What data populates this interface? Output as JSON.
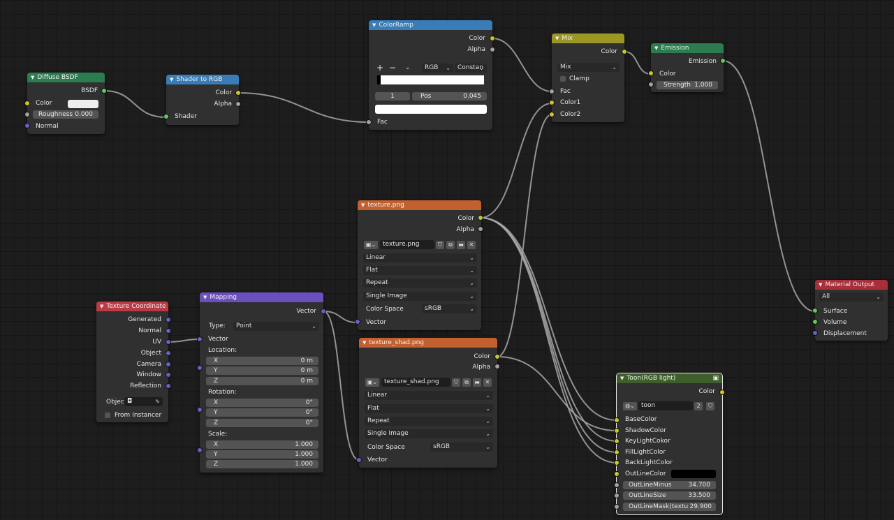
{
  "colors": {
    "shader_header": "#2b7d4f",
    "converter_header": "#3a7db6",
    "color_header": "#9c9626",
    "texture_header": "#c2612f",
    "input_header": "#b83b45",
    "vector_header": "#6c4fbf",
    "output_header": "#a82e3a",
    "group_header": "#3e5f2c",
    "socket_color": "#c7c729",
    "socket_float": "#a1a1a1",
    "socket_shader": "#63c763",
    "socket_vector": "#6363c7"
  },
  "diffuse": {
    "title": "Diffuse BSDF",
    "out_bsdf": "BSDF",
    "in_color": "Color",
    "roughness_label": "Roughness",
    "roughness_value": "0.000",
    "in_normal": "Normal"
  },
  "shader_to_rgb": {
    "title": "Shader to RGB",
    "out_color": "Color",
    "out_alpha": "Alpha",
    "in_shader": "Shader"
  },
  "colorramp": {
    "title": "ColorRamp",
    "out_color": "Color",
    "out_alpha": "Alpha",
    "add_icon": "+",
    "remove_icon": "−",
    "menu_icon": "⌄",
    "mode": "RGB",
    "interpolation": "Constan",
    "index": "1",
    "pos_label": "Pos",
    "pos_value": "0.045",
    "in_fac": "Fac"
  },
  "mix": {
    "title": "Mix",
    "out_color": "Color",
    "blend_mode": "Mix",
    "clamp_label": "Clamp",
    "in_fac": "Fac",
    "in_color1": "Color1",
    "in_color2": "Color2"
  },
  "emission": {
    "title": "Emission",
    "out_emission": "Emission",
    "in_color": "Color",
    "strength_label": "Strength",
    "strength_value": "1.000"
  },
  "material_output": {
    "title": "Material Output",
    "target": "All",
    "in_surface": "Surface",
    "in_volume": "Volume",
    "in_displacement": "Displacement"
  },
  "texture": {
    "title": "texture.png",
    "out_color": "Color",
    "out_alpha": "Alpha",
    "image_name": "texture.png",
    "interpolation": "Linear",
    "projection": "Flat",
    "extension": "Repeat",
    "source": "Single Image",
    "color_space_label": "Color Space",
    "color_space": "sRGB",
    "in_vector": "Vector"
  },
  "texture_shad": {
    "title": "texture_shad.png",
    "out_color": "Color",
    "out_alpha": "Alpha",
    "image_name": "texture_shad.png",
    "interpolation": "Linear",
    "projection": "Flat",
    "extension": "Repeat",
    "source": "Single Image",
    "color_space_label": "Color Space",
    "color_space": "sRGB",
    "in_vector": "Vector"
  },
  "texcoord": {
    "title": "Texture Coordinate",
    "outputs": [
      "Generated",
      "Normal",
      "UV",
      "Object",
      "Camera",
      "Window",
      "Reflection"
    ],
    "object_label": "Objec",
    "from_instancer": "From Instancer"
  },
  "mapping": {
    "title": "Mapping",
    "out_vector": "Vector",
    "type_label": "Type:",
    "type_value": "Point",
    "in_vector": "Vector",
    "location_label": "Location:",
    "location": [
      {
        "axis": "X",
        "value": "0 m"
      },
      {
        "axis": "Y",
        "value": "0 m"
      },
      {
        "axis": "Z",
        "value": "0 m"
      }
    ],
    "rotation_label": "Rotation:",
    "rotation": [
      {
        "axis": "X",
        "value": "0°"
      },
      {
        "axis": "Y",
        "value": "0°"
      },
      {
        "axis": "Z",
        "value": "0°"
      }
    ],
    "scale_label": "Scale:",
    "scale": [
      {
        "axis": "X",
        "value": "1.000"
      },
      {
        "axis": "Y",
        "value": "1.000"
      },
      {
        "axis": "Z",
        "value": "1.000"
      }
    ]
  },
  "toon": {
    "title": "Toon(RGB light)",
    "out_color": "Color",
    "group_name": "toon",
    "users": "2",
    "inputs": [
      "BaseColor",
      "ShadowColor",
      "KeyLightCokor",
      "FillLightColor",
      "BackLightColor"
    ],
    "outline_color_label": "OutLineColor",
    "outline_minus_label": "OutLineMinus",
    "outline_minus_value": "34.700",
    "outline_size_label": "OutLineSize",
    "outline_size_value": "33.500",
    "outline_mask_label": "OutLineMask(textur",
    "outline_mask_value": "29.900"
  }
}
